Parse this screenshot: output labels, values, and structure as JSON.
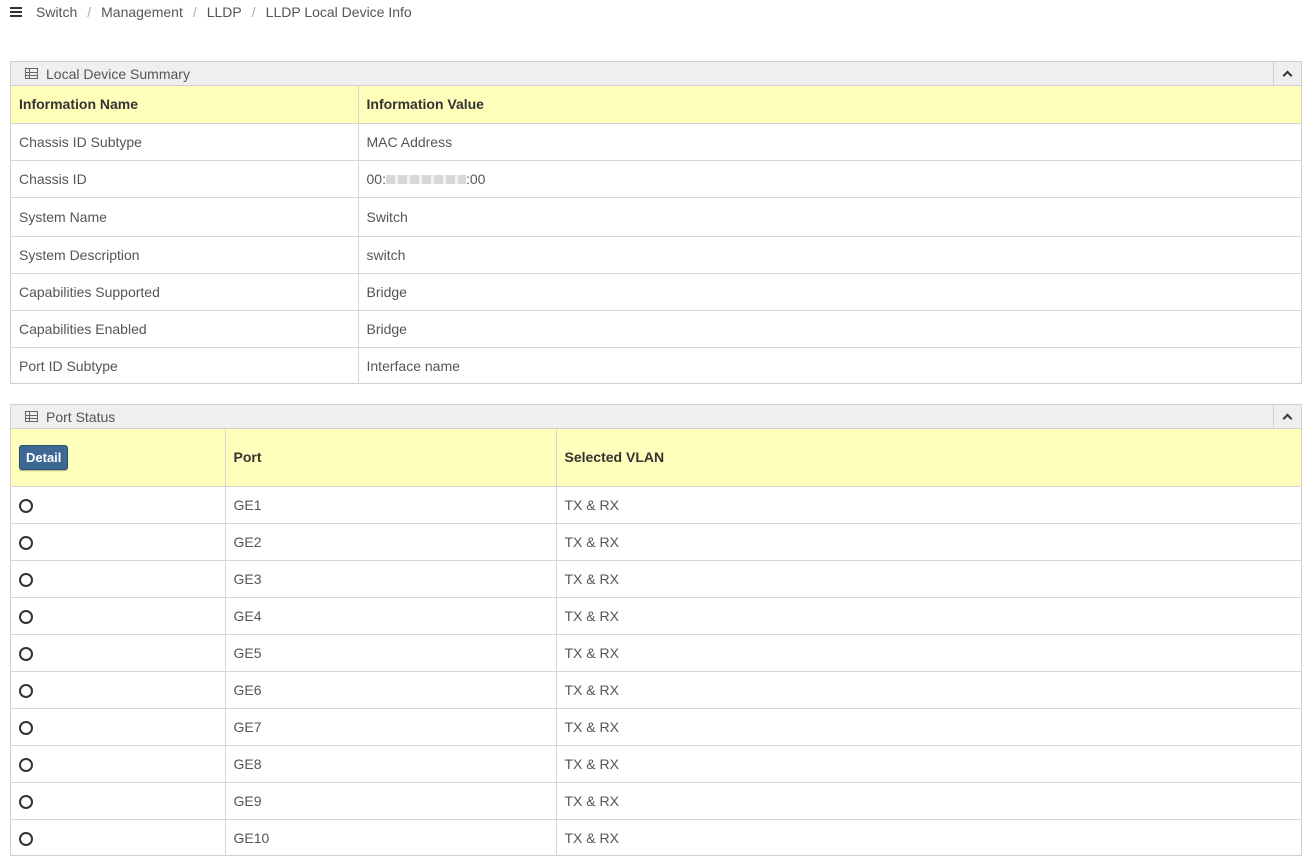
{
  "breadcrumb": [
    "Switch",
    "Management",
    "LLDP",
    "LLDP Local Device Info"
  ],
  "summary": {
    "title": "Local Device Summary",
    "headers": [
      "Information Name",
      "Information Value"
    ],
    "rows": [
      {
        "name": "Chassis ID Subtype",
        "value": "MAC Address"
      },
      {
        "name": "Chassis ID",
        "value_prefix": "00:",
        "value_suffix": ":00"
      },
      {
        "name": "System Name",
        "value": "Switch"
      },
      {
        "name": "System Description",
        "value": "switch"
      },
      {
        "name": "Capabilities Supported",
        "value": "Bridge"
      },
      {
        "name": "Capabilities Enabled",
        "value": "Bridge"
      },
      {
        "name": "Port ID Subtype",
        "value": "Interface name"
      }
    ]
  },
  "ports": {
    "title": "Port Status",
    "detail_label": "Detail",
    "headers": [
      "Port",
      "Selected VLAN"
    ],
    "rows": [
      {
        "port": "GE1",
        "vlan": "TX & RX"
      },
      {
        "port": "GE2",
        "vlan": "TX & RX"
      },
      {
        "port": "GE3",
        "vlan": "TX & RX"
      },
      {
        "port": "GE4",
        "vlan": "TX & RX"
      },
      {
        "port": "GE5",
        "vlan": "TX & RX"
      },
      {
        "port": "GE6",
        "vlan": "TX & RX"
      },
      {
        "port": "GE7",
        "vlan": "TX & RX"
      },
      {
        "port": "GE8",
        "vlan": "TX & RX"
      },
      {
        "port": "GE9",
        "vlan": "TX & RX"
      },
      {
        "port": "GE10",
        "vlan": "TX & RX"
      }
    ]
  }
}
